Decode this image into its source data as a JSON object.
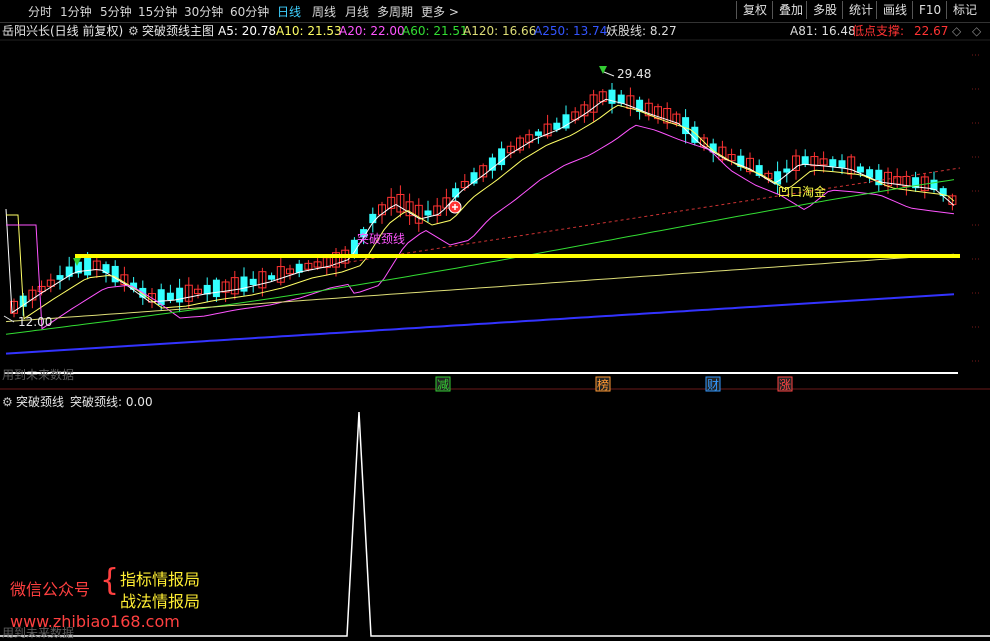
{
  "toolbar": {
    "periods": [
      "分时",
      "1分钟",
      "5分钟",
      "15分钟",
      "30分钟",
      "60分钟",
      "日线",
      "周线",
      "月线",
      "多周期",
      "更多 >"
    ],
    "active_period": "日线",
    "right_buttons": [
      "复权",
      "叠加",
      "多股",
      "统计",
      "画线",
      "F10",
      "标记"
    ]
  },
  "info": {
    "stock": "岳阳兴长(日线 前复权)",
    "indicator_name": "突破颈线主图",
    "ma5": "A5: 20.78",
    "ma10": "A10: 21.53",
    "ma20": "A20: 22.00",
    "ma60": "A60: 21.51",
    "ma120": "A120: 16.66",
    "ma250": "A250: 13.74",
    "yao": "妖股线: 8.27",
    "a81": "A81: 16.48",
    "low_support_label": "低点支撑:",
    "low_support_value": "22.67",
    "colors": {
      "ma5": "#ffffff",
      "ma10": "#ffff66",
      "ma20": "#ff55ff",
      "ma60": "#33dd33",
      "ma120": "#dddd77",
      "ma250": "#3355ff",
      "low_support": "#ff3333"
    }
  },
  "main_chart": {
    "high_label": "29.48",
    "low_label": "12.00",
    "neckline_label": "突破颈线",
    "gap_label": "凹口淘金",
    "future_data_label": "用到未来数据",
    "events": [
      {
        "label": "减",
        "color": "#33cc33"
      },
      {
        "label": "榜",
        "color": "#ff9933"
      },
      {
        "label": "财",
        "color": "#3399ff"
      },
      {
        "label": "涨",
        "color": "#ff4444"
      }
    ]
  },
  "indicator_panel": {
    "title": "突破颈线",
    "value": "突破颈线: 0.00",
    "future_data_label": "用到未来数据"
  },
  "watermark": {
    "account_label": "微信公众号",
    "name1": "指标情报局",
    "name2": "战法情报局",
    "site": "www.zhibiao168.com"
  }
}
